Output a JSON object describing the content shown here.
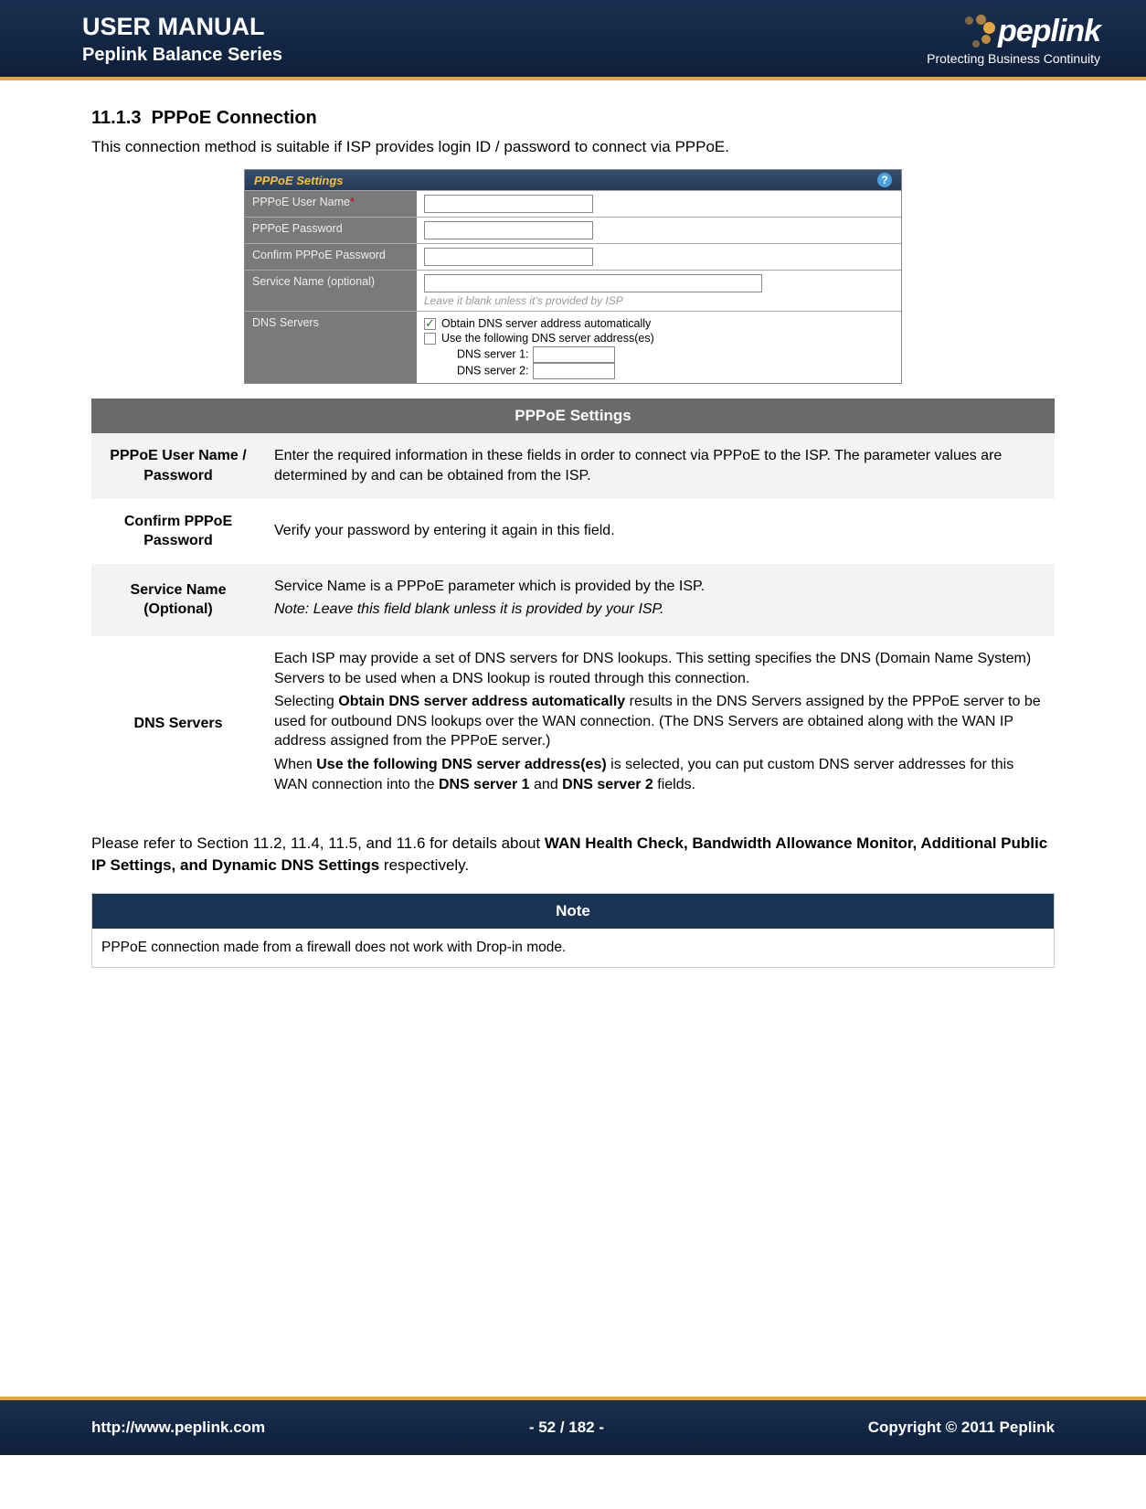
{
  "header": {
    "title": "USER MANUAL",
    "subtitle": "Peplink Balance Series",
    "brand": "peplink",
    "tagline": "Protecting Business Continuity"
  },
  "section": {
    "number": "11.1.3",
    "title": "PPPoE Connection",
    "intro": "This connection method is suitable if ISP provides login ID / password to connect via PPPoE."
  },
  "form": {
    "heading": "PPPoE Settings",
    "help_symbol": "?",
    "rows": {
      "user": "PPPoE User Name",
      "pass": "PPPoE Password",
      "confirm": "Confirm PPPoE Password",
      "service": "Service Name (optional)",
      "service_hint": "Leave it blank unless it's provided by ISP",
      "dns": "DNS Servers",
      "dns_auto": "Obtain DNS server address automatically",
      "dns_manual": "Use the following DNS server address(es)",
      "dns1": "DNS server 1:",
      "dns2": "DNS server 2:"
    }
  },
  "desc": {
    "heading": "PPPoE Settings",
    "rows": [
      {
        "label": "PPPoE User Name / Password",
        "text": "Enter the required information in these fields in order to connect via PPPoE to the ISP.  The parameter values are determined by and can be obtained from the ISP."
      },
      {
        "label": "Confirm PPPoE Password",
        "text": "Verify your password by entering it again in this field."
      },
      {
        "label": "Service Name (Optional)",
        "text": "Service Name is a PPPoE parameter which is provided by the ISP.",
        "note": "Note: Leave this field blank unless it is provided by your ISP."
      },
      {
        "label": "DNS Servers",
        "para1": "Each ISP may provide a set of DNS servers for DNS lookups.  This setting specifies the DNS (Domain Name System) Servers to be used when a DNS lookup is routed through this connection.",
        "para2_a": "Selecting ",
        "para2_b": "Obtain DNS server address automatically",
        "para2_c": " results in the DNS Servers assigned by the PPPoE server to be used for outbound DNS lookups over the WAN connection.  (The DNS Servers are obtained along with the WAN IP address assigned from the PPPoE server.)",
        "para3_a": "When ",
        "para3_b": "Use the following DNS server address(es)",
        "para3_c": " is selected, you can put custom DNS server addresses for this WAN connection into the ",
        "para3_d": "DNS server 1",
        "para3_e": " and ",
        "para3_f": "DNS server 2",
        "para3_g": " fields."
      }
    ]
  },
  "refpara_a": "Please refer to Section 11.2, 11.4, 11.5, and 11.6 for details about ",
  "refpara_b": "WAN Health Check, Bandwidth Allowance Monitor, Additional Public IP Settings, and Dynamic DNS Settings",
  "refpara_c": " respectively.",
  "notebox": {
    "heading": "Note",
    "text": "PPPoE connection made from a firewall does not work with Drop-in mode."
  },
  "footer": {
    "url": "http://www.peplink.com",
    "page": "- 52 / 182 -",
    "copyright": "Copyright © 2011 Peplink"
  }
}
